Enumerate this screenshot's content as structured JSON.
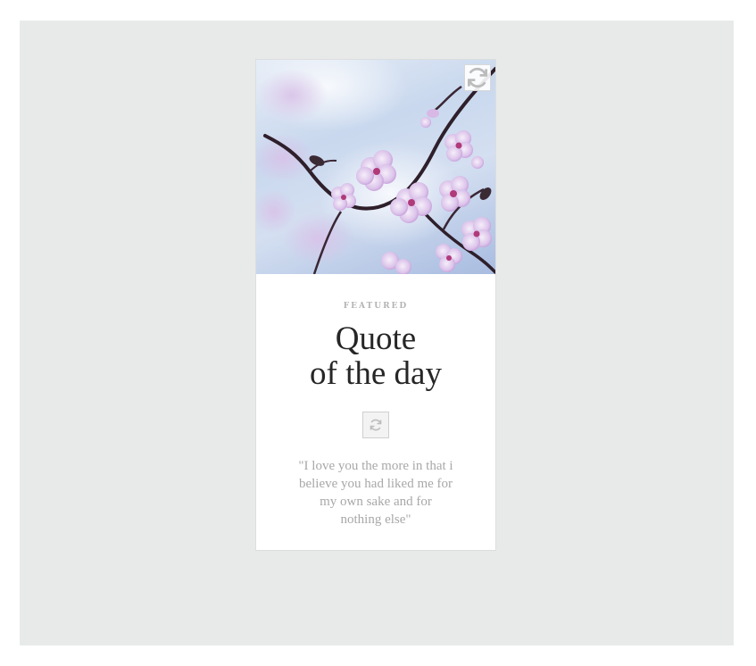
{
  "card": {
    "eyebrow": "FEATURED",
    "title_line1": "Quote",
    "title_line2": "of the day",
    "quote": "\"I love you the more in that i believe you had liked me for my own sake and for nothing else\""
  },
  "icons": {
    "corner_refresh": "refresh-icon",
    "center_refresh": "refresh-icon"
  },
  "colors": {
    "stage_background": "#e8eaea",
    "card_background": "#ffffff",
    "title_text": "#262626",
    "quote_text": "#a8a8a8",
    "eyebrow_text": "#b4b4b4",
    "blossom": "#c7a6d6",
    "branch": "#2e1f2a"
  }
}
